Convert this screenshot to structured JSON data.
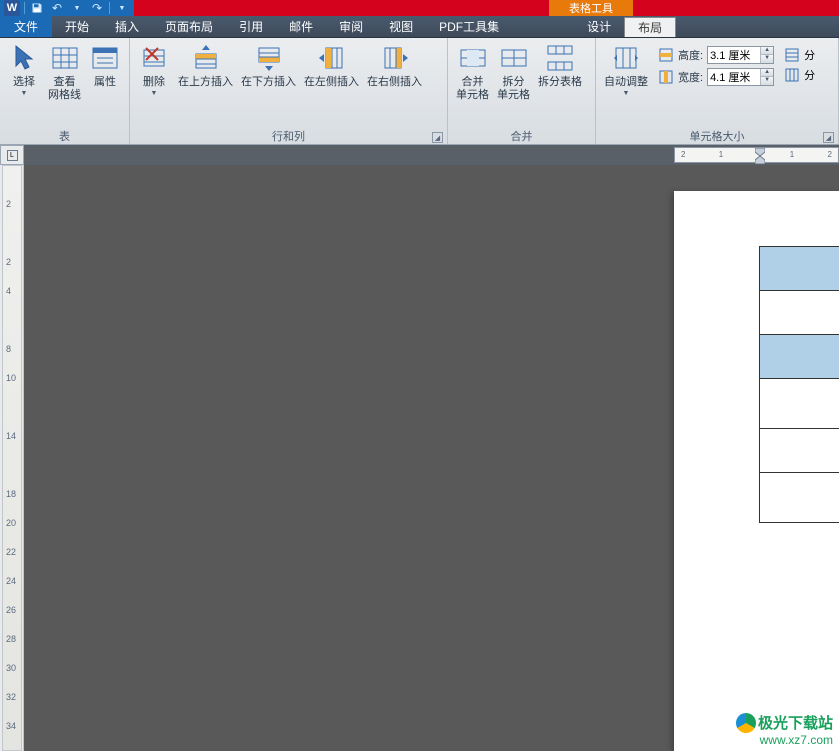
{
  "qat": {
    "app_letter": "W"
  },
  "context_tab": "表格工具",
  "tabs": {
    "file": "文件",
    "home": "开始",
    "insert": "插入",
    "page_layout": "页面布局",
    "references": "引用",
    "mailings": "邮件",
    "review": "审阅",
    "view": "视图",
    "pdf_tools": "PDF工具集",
    "design": "设计",
    "layout": "布局"
  },
  "ribbon": {
    "table_group": {
      "label": "表",
      "select": "选择",
      "gridlines": "查看\n网格线",
      "properties": "属性"
    },
    "rowscols_group": {
      "label": "行和列",
      "delete": "删除",
      "insert_above": "在上方插入",
      "insert_below": "在下方插入",
      "insert_left": "在左侧插入",
      "insert_right": "在右侧插入"
    },
    "merge_group": {
      "label": "合并",
      "merge_cells": "合并\n单元格",
      "split_cells": "拆分\n单元格",
      "split_table": "拆分表格"
    },
    "cellsize_group": {
      "label": "单元格大小",
      "autofit": "自动调整",
      "height_label": "高度:",
      "width_label": "宽度:",
      "height_value": "3.1 厘米",
      "width_value": "4.1 厘米",
      "dist_rows": "分",
      "dist_cols": "分"
    }
  },
  "ruler": {
    "h_numbers": [
      "2",
      "1",
      "",
      "1",
      "2"
    ]
  },
  "vruler_numbers": [
    "",
    "2",
    "",
    "2",
    "4",
    "",
    "8",
    "10",
    "",
    "14",
    "",
    "18",
    "20",
    "22",
    "24",
    "26",
    "28",
    "30",
    "32",
    "34"
  ],
  "watermark": {
    "line1": "极光下载站",
    "line2": "www.xz7.com"
  }
}
